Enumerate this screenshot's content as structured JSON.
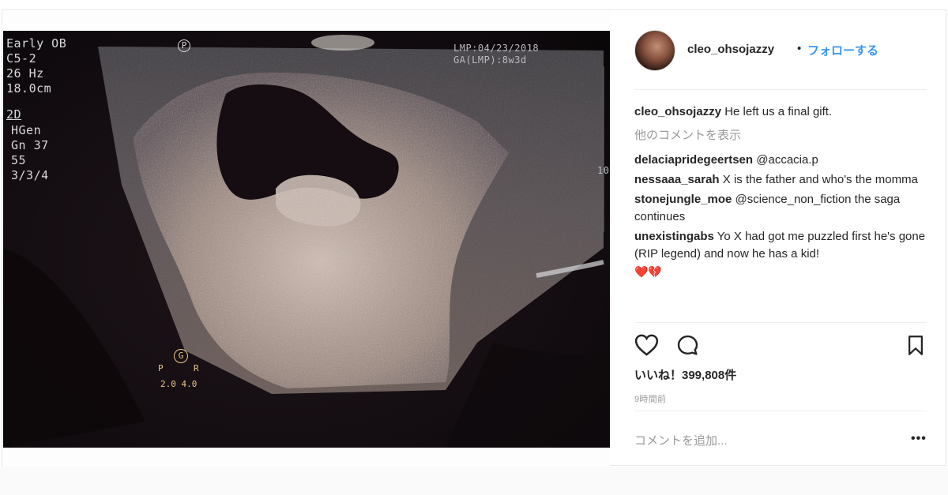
{
  "post": {
    "ultrasound": {
      "left_block": "Early OB\nC5-2\n26 Hz\n18.0cm",
      "mode_label": "2D",
      "settings": "HGen\nGn 37\n55\n3/3/4",
      "top_right": "LMP:04/23/2018\nGA(LMP):8w3d",
      "probe_marker": "P",
      "orientation_center": "G",
      "orientation_left": "P",
      "orientation_right": "R",
      "orientation_scale": "2.0 4.0",
      "depth_mark": "10"
    },
    "author": {
      "username": "cleo_ohsojazzy",
      "dot": "•",
      "follow_label": "フォローする"
    },
    "caption": {
      "username": "cleo_ohsojazzy",
      "text": "He left us a final gift."
    },
    "view_more_comments": "他のコメントを表示",
    "comments": [
      {
        "username": "delaciapridegeertsen",
        "text": "@accacia.p"
      },
      {
        "username": "nessaaa_sarah",
        "text": "X is the father and who's the momma"
      },
      {
        "username": "stonejungle_moe",
        "text": "@science_non_fiction the saga continues"
      },
      {
        "username": "unexistingabs",
        "text": "Yo X had got me puzzled first he's gone (RIP legend) and now he has a kid!",
        "emoji": "❤️💔"
      }
    ],
    "likes_text": "いいね！399,808件",
    "timestamp": "9時間前",
    "add_comment_placeholder": "コメントを追加...",
    "more_options": "•••"
  },
  "colors": {
    "follow_blue": "#3897f0",
    "text_primary": "#262626",
    "text_muted": "#999999",
    "divider": "#efefef"
  },
  "icons": [
    "heart-icon",
    "comment-icon",
    "bookmark-icon",
    "more-options-icon"
  ]
}
